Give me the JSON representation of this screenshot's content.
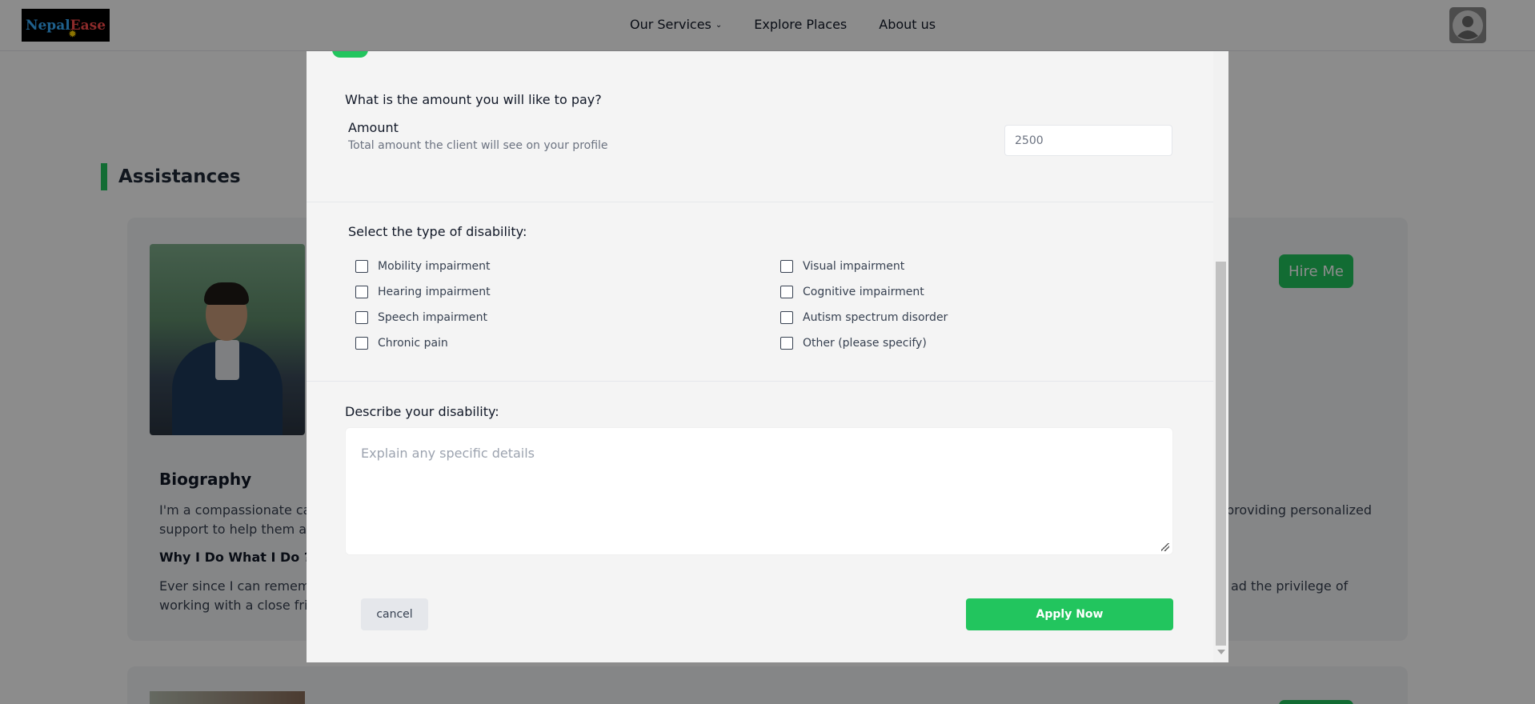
{
  "nav": {
    "logo_part1": "Nepal",
    "logo_part2": "Ease",
    "links": [
      "Our Services",
      "Explore Places",
      "About us"
    ]
  },
  "background": {
    "section_title": "Assistances",
    "hire_label": "Hire Me",
    "bio_title": "Biography",
    "bio_text_left": "I'm a compassionate car",
    "bio_text_right": "providing personalized",
    "bio_text_line2": "support to help them ac",
    "why_title": "Why I Do What I Do ?",
    "why_text_left": "Ever since I can rememb",
    "why_text_right": "ad the privilege of",
    "why_text_line2": "working with a close frie"
  },
  "modal": {
    "amount_question": "What is the amount you will like to pay?",
    "amount_label": "Amount",
    "amount_help": "Total amount the client will see on your profile",
    "amount_placeholder": "2500",
    "disability_question": "Select the type of disability:",
    "disabilities_left": [
      "Mobility impairment",
      "Hearing impairment",
      "Speech impairment",
      "Chronic pain"
    ],
    "disabilities_right": [
      "Visual impairment",
      "Cognitive impairment",
      "Autism spectrum disorder",
      "Other (please specify)"
    ],
    "describe_question": "Describe your disability:",
    "describe_placeholder": "Explain any specific details",
    "cancel_label": "cancel",
    "apply_label": "Apply Now"
  },
  "colors": {
    "accent": "#22c55e",
    "overlay": "rgba(0,0,0,0.45)"
  }
}
